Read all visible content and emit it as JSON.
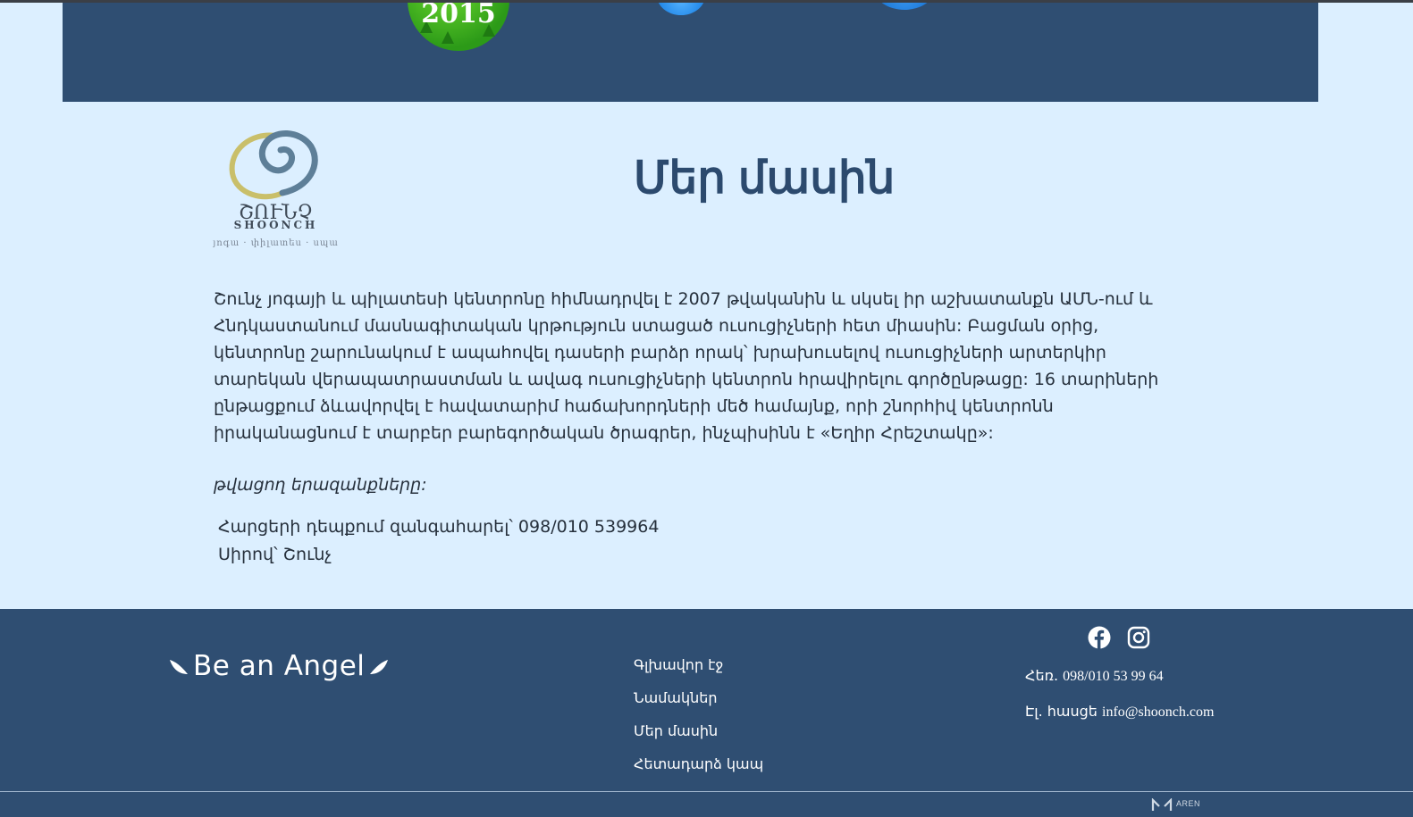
{
  "hero": {
    "year_badge": "2015"
  },
  "logo": {
    "name": "ՇՈՒՆՉ",
    "latin": "SHOONCH",
    "tagline": "յոգա · փիլատես · սպա"
  },
  "about": {
    "title": "Մեր մասին",
    "paragraph": "Շունչ յոգայի և պիլատեսի կենտրոնը հիմնադրվել է 2007 թվականին և սկսել իր աշխատանքն ԱՄՆ-ում և Հնդկաստանում մասնագիտական կրթություն ստացած ուսուցիչների հետ միասին: Բացման օրից, կենտրոնը շարունակում է ապահովել դասերի բարձր որակ՝ խրախուսելով ուսուցիչների արտերկիր տարեկան վերապատրաստման և ավագ ուսուցիչների կենտրոն հրավիրելու գործընթացը: 16 տարիների ընթացքում ձևավորվել է հավատարիմ հաճախորդների մեծ համայնք, որի շնորհիվ կենտրոնն իրականացնում է տարբեր բարեգործական ծրագրեր, ինչպիսինն է «Եղիր Հրեշտակը»:",
    "past_label": "թվացող երազանքները:",
    "contact_text": "Հարցերի դեպքում զանգահարել՝ 098/010 539964",
    "signoff": "Սիրով՝ Շունչ"
  },
  "footer": {
    "brand": "Be an Angel",
    "nav": [
      "Գլխավոր էջ",
      "Նամակներ",
      "Մեր մասին",
      "Հետադարձ կապ"
    ],
    "phone_label": "Հեռ.",
    "phone": "098/010 53 99 64",
    "email_label": "Էլ. հասցե",
    "email": "info@shoonch.com",
    "credit": "AREN",
    "social_icons": [
      "facebook-icon",
      "instagram-icon"
    ]
  },
  "colors": {
    "page_bg": "#dcefff",
    "band": "#2f4e72",
    "title": "#2c4a6e"
  }
}
